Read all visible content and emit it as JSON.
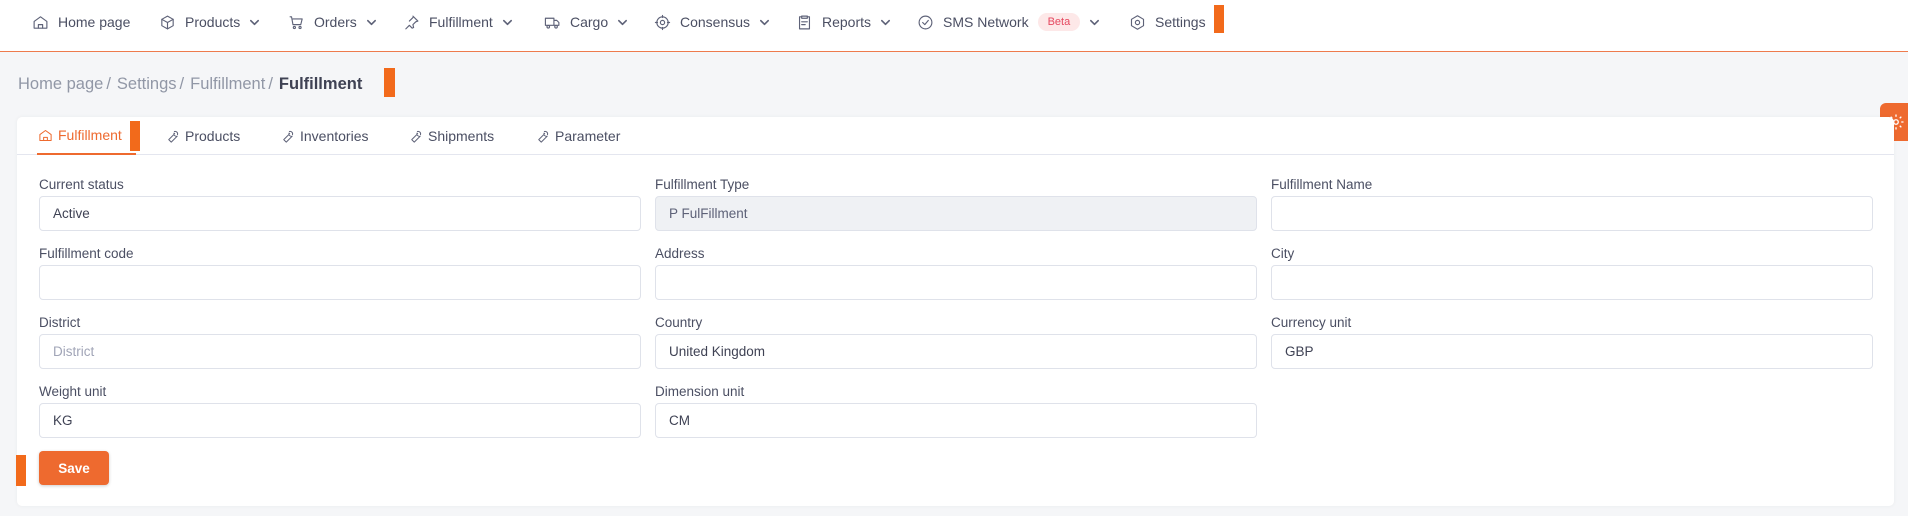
{
  "nav": {
    "home": "Home page",
    "products": "Products",
    "orders": "Orders",
    "fulfillment": "Fulfillment",
    "cargo": "Cargo",
    "consensus": "Consensus",
    "reports": "Reports",
    "sms_network": "SMS Network",
    "beta_badge": "Beta",
    "settings": "Settings"
  },
  "breadcrumb": {
    "items": [
      "Home page",
      "Settings",
      "Fulfillment"
    ],
    "separator": "/",
    "current": "Fulfillment"
  },
  "tabs": [
    {
      "label": "Fulfillment",
      "icon": "home-icon",
      "active": true
    },
    {
      "label": "Products",
      "icon": "wrench-icon",
      "active": false
    },
    {
      "label": "Inventories",
      "icon": "wrench-icon",
      "active": false
    },
    {
      "label": "Shipments",
      "icon": "wrench-icon",
      "active": false
    },
    {
      "label": "Parameter",
      "icon": "wrench-icon",
      "active": false
    }
  ],
  "form": {
    "current_status": {
      "label": "Current status",
      "value": "Active"
    },
    "fulfillment_type": {
      "label": "Fulfillment Type",
      "value": "P FulFillment"
    },
    "fulfillment_name": {
      "label": "Fulfillment Name",
      "value": ""
    },
    "fulfillment_code": {
      "label": "Fulfillment code",
      "value": ""
    },
    "address": {
      "label": "Address",
      "value": ""
    },
    "city": {
      "label": "City",
      "value": ""
    },
    "district": {
      "label": "District",
      "value": "",
      "placeholder": "District"
    },
    "country": {
      "label": "Country",
      "value": "United Kingdom"
    },
    "currency_unit": {
      "label": "Currency unit",
      "value": "GBP"
    },
    "weight_unit": {
      "label": "Weight unit",
      "value": "KG"
    },
    "dimension_unit": {
      "label": "Dimension unit",
      "value": "CM"
    }
  },
  "save_label": "Save",
  "colors": {
    "accent": "#ee6a2f",
    "marker": "#f26a1b",
    "beta_bg": "#fde8e8",
    "beta_text": "#e5485f"
  }
}
